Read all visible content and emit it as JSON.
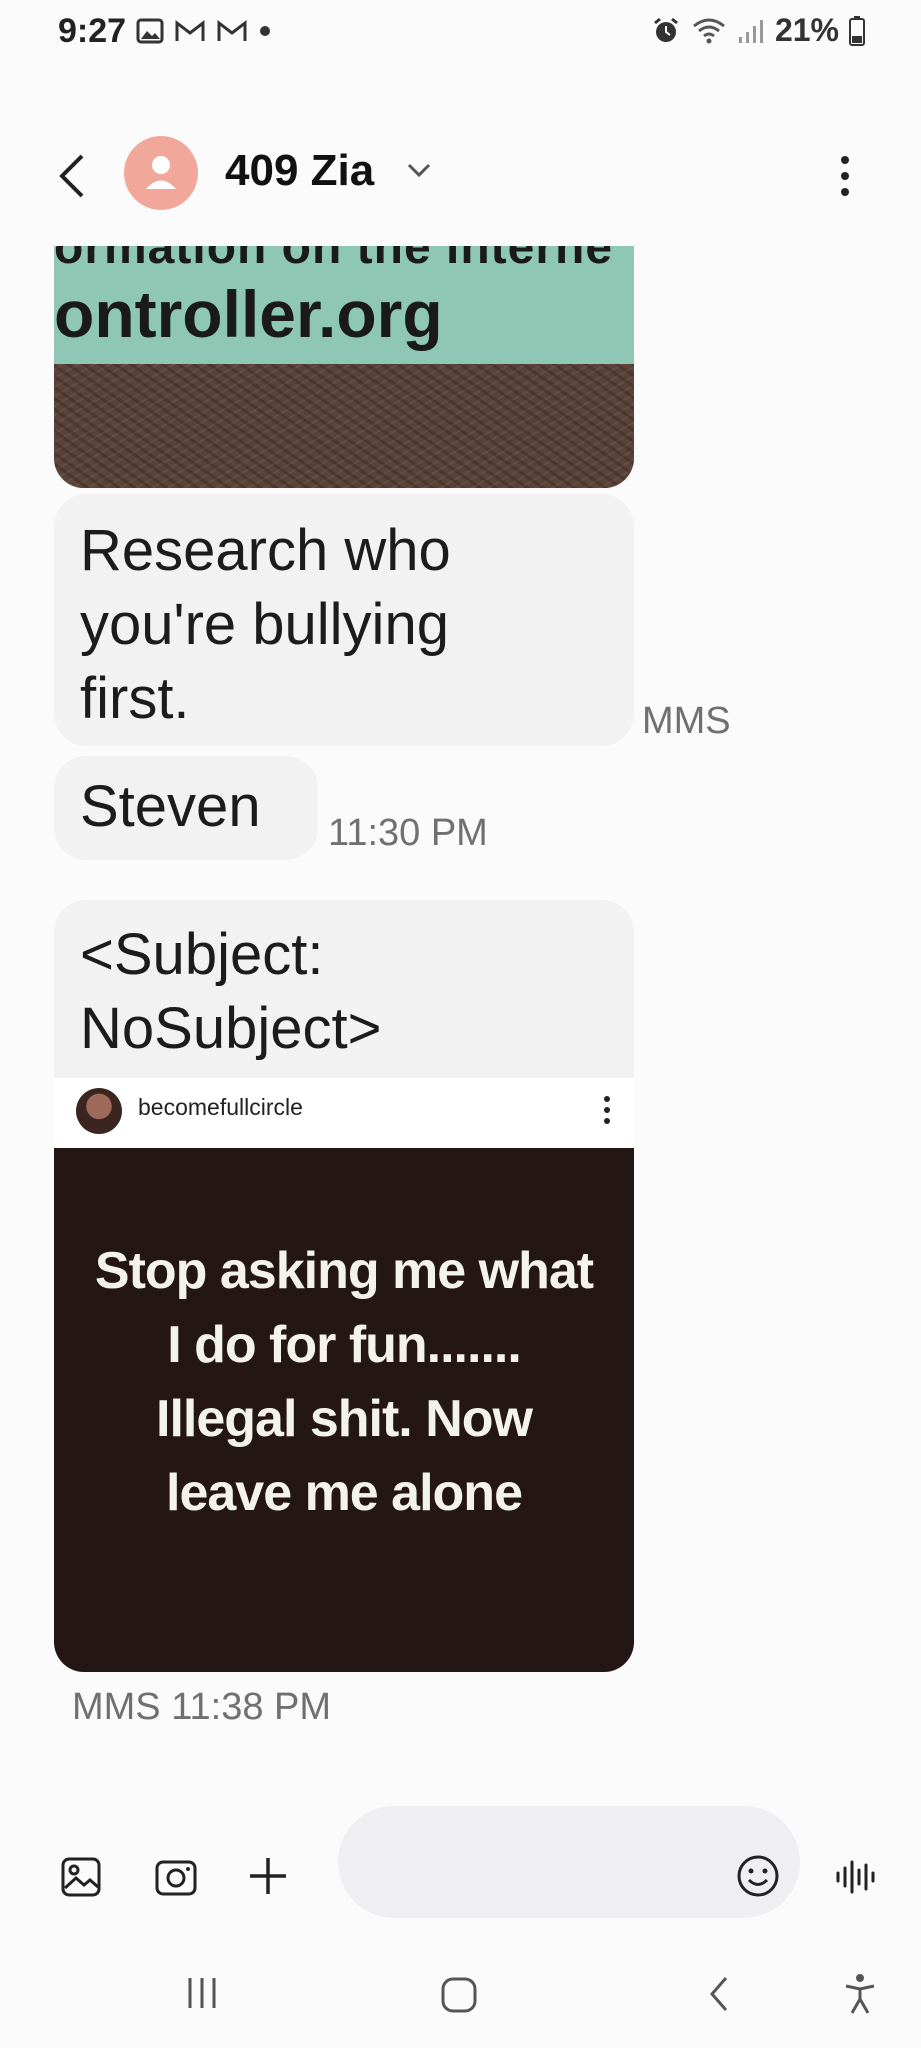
{
  "status_bar": {
    "time": "9:27",
    "battery": "21%",
    "left_icons": [
      "image-notification-icon",
      "gmail-icon",
      "gmail-icon",
      "dot-icon"
    ],
    "right_icons": [
      "alarm-icon",
      "wifi-icon",
      "signal-icon",
      "battery-icon"
    ]
  },
  "header": {
    "contact_name": "409 Zia",
    "avatar_color": "#f2a79b"
  },
  "messages": {
    "image1": {
      "partial_text_top": "ormation on the interne",
      "partial_text_main": "ontroller.org"
    },
    "text1": {
      "line1": "Research who",
      "line2": "you're bullying",
      "line3": "first."
    },
    "text1_meta": "MMS",
    "text2": "Steven",
    "text2_time": "11:30 PM",
    "subject": {
      "line1": "<Subject:",
      "line2": "NoSubject>"
    },
    "ig_post": {
      "username": "becomefullcircle",
      "caption_line1": "Stop asking me what",
      "caption_line2": "I do for fun.......",
      "caption_line3": "Illegal shit. Now",
      "caption_line4": "leave me alone"
    },
    "last_meta": "MMS 11:38 PM"
  },
  "input_bar": {
    "placeholder": "",
    "icons": [
      "gallery-icon",
      "camera-icon",
      "plus-icon",
      "emoji-icon",
      "voice-icon"
    ]
  },
  "nav_bar": {
    "icons": [
      "recent-apps-icon",
      "home-icon",
      "back-icon",
      "accessibility-icon"
    ]
  },
  "colors": {
    "background": "#fbfbfc",
    "bubble": "#f2f2f3",
    "meta_text": "#707070"
  }
}
